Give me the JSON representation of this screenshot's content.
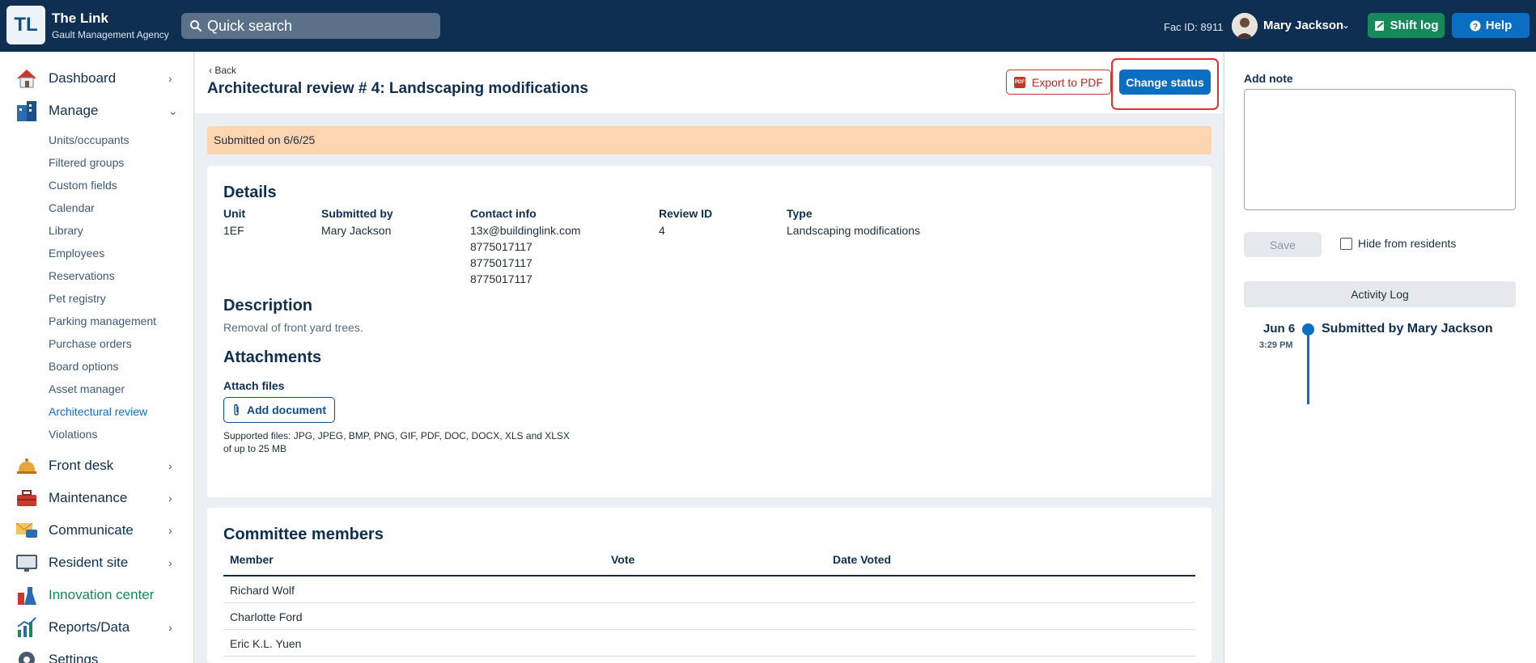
{
  "brand": {
    "logo": "TL",
    "name": "The Link",
    "subtitle": "Gault Management Agency"
  },
  "search": {
    "placeholder": "Quick search"
  },
  "header": {
    "fac_id": "Fac ID: 8911",
    "user_name": "Mary Jackson",
    "shift_log": "Shift log",
    "help": "Help"
  },
  "sidebar": {
    "top_items": [
      {
        "label": "Dashboard",
        "icon": "house-icon"
      },
      {
        "label": "Manage",
        "icon": "building-icon"
      },
      {
        "label": "Front desk",
        "icon": "bell-icon"
      },
      {
        "label": "Maintenance",
        "icon": "toolbox-icon"
      },
      {
        "label": "Communicate",
        "icon": "envelope-chat-icon"
      },
      {
        "label": "Resident site",
        "icon": "monitor-icon"
      },
      {
        "label": "Innovation center",
        "icon": "flask-icon"
      },
      {
        "label": "Reports/Data",
        "icon": "chart-icon"
      },
      {
        "label": "Settings",
        "icon": "gear-icon"
      }
    ],
    "manage_items": [
      "Units/occupants",
      "Filtered groups",
      "Custom fields",
      "Calendar",
      "Library",
      "Employees",
      "Reservations",
      "Pet registry",
      "Parking management",
      "Purchase orders",
      "Board options",
      "Asset manager",
      "Architectural review",
      "Violations"
    ]
  },
  "page": {
    "back": "Back",
    "title": "Architectural review # 4: Landscaping modifications",
    "export_pdf": "Export to PDF",
    "change_status": "Change status",
    "banner": "Submitted on 6/6/25"
  },
  "details": {
    "heading": "Details",
    "unit_label": "Unit",
    "unit": "1EF",
    "submitted_by_label": "Submitted by",
    "submitted_by": "Mary Jackson",
    "contact_label": "Contact info",
    "contact_lines": [
      "13x@buildinglink.com",
      "8775017117",
      "8775017117",
      "8775017117"
    ],
    "review_id_label": "Review ID",
    "review_id": "4",
    "type_label": "Type",
    "type": "Landscaping modifications",
    "description_heading": "Description",
    "description": "Removal of front yard trees.",
    "attachments_heading": "Attachments",
    "attach_files_label": "Attach files",
    "add_document": "Add document",
    "supported_line1": "Supported files: JPG, JPEG, BMP, PNG, GIF, PDF, DOC, DOCX, XLS and XLSX",
    "supported_line2": "of up to 25 MB"
  },
  "committee": {
    "heading": "Committee members",
    "columns": [
      "Member",
      "Vote",
      "Date Voted"
    ],
    "members": [
      "Richard Wolf",
      "Charlotte Ford",
      "Eric K.L. Yuen"
    ]
  },
  "right_panel": {
    "add_note": "Add note",
    "save": "Save",
    "hide_from_residents": "Hide from residents",
    "activity_log": "Activity Log",
    "entries": [
      {
        "date": "Jun 6",
        "time": "3:29 PM",
        "text": "Submitted by Mary Jackson"
      }
    ]
  },
  "colors": {
    "topbar": "#0e2f52",
    "accent": "#0a6fc2",
    "green": "#16885a",
    "banner": "#fdd5b1",
    "highlight": "#e03131"
  }
}
